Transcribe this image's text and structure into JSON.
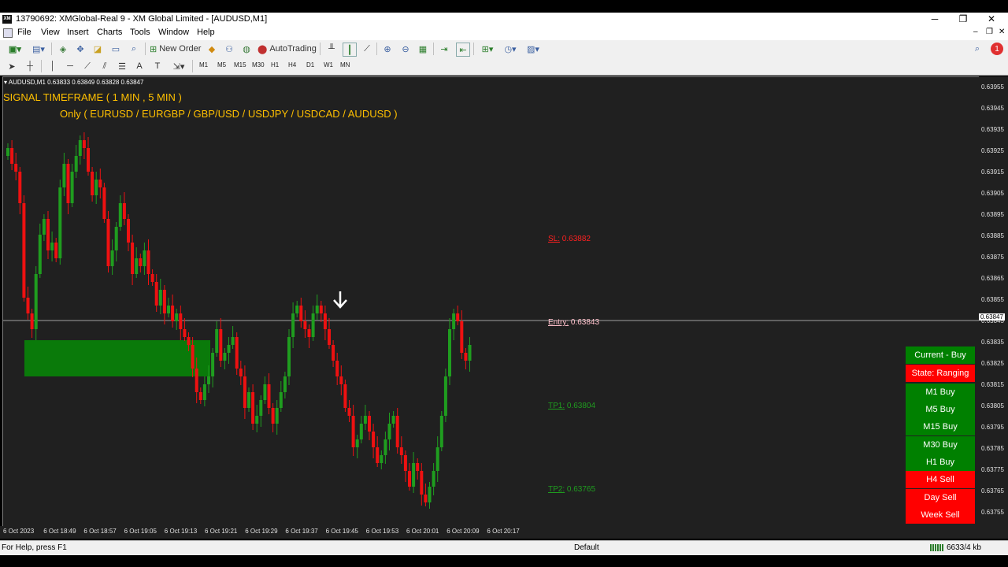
{
  "window": {
    "title": "13790692: XMGlobal-Real 9 - XM Global Limited - [AUDUSD,M1]",
    "logo_text": "XM",
    "controls": [
      "─",
      "❐",
      "✕"
    ]
  },
  "menu": [
    "File",
    "View",
    "Insert",
    "Charts",
    "Tools",
    "Window",
    "Help"
  ],
  "toolbar": {
    "new_order": "New Order",
    "autotrading": "AutoTrading"
  },
  "timeframes": [
    "M1",
    "M5",
    "M15",
    "M30",
    "H1",
    "H4",
    "D1",
    "W1",
    "MN"
  ],
  "chart": {
    "header": "AUDUSD,M1  0.63833 0.63849 0.63828 0.63847",
    "signal_title": "SIGNAL TIMEFRAME ( 1 MIN , 5 MIN )",
    "pairs_note": "Only ( EURUSD / EURGBP / GBP/USD / USDJPY / USDCAD / AUDUSD )",
    "current_price": "0.63847",
    "levels": [
      {
        "label": "SL:",
        "value": "0.63882",
        "color": "#ff2020"
      },
      {
        "label": "Entry:",
        "value": "0.63843",
        "color": "#ffc0cb"
      },
      {
        "label": "TP1:",
        "value": "0.63804",
        "color": "#1f9d1f"
      },
      {
        "label": "TP2:",
        "value": "0.63765",
        "color": "#1f9d1f"
      }
    ],
    "price_ticks": [
      "0.63955",
      "0.63945",
      "0.63935",
      "0.63925",
      "0.63915",
      "0.63905",
      "0.63895",
      "0.63885",
      "0.63875",
      "0.63865",
      "0.63855",
      "0.63845",
      "0.63835",
      "0.63825",
      "0.63815",
      "0.63805",
      "0.63795",
      "0.63785",
      "0.63775",
      "0.63765",
      "0.63755"
    ],
    "time_ticks": [
      "6 Oct 2023",
      "6 Oct 18:49",
      "6 Oct 18:57",
      "6 Oct 19:05",
      "6 Oct 19:13",
      "6 Oct 19:21",
      "6 Oct 19:29",
      "6 Oct 19:37",
      "6 Oct 19:45",
      "6 Oct 19:53",
      "6 Oct 20:01",
      "6 Oct 20:09",
      "6 Oct 20:17"
    ],
    "colors": {
      "bull": "#1f9d1f",
      "bear": "#ee1111",
      "background": "#202020",
      "signal": "#ffc000"
    }
  },
  "signal_panel": [
    {
      "text": "Current - Buy",
      "color": "#008000"
    },
    {
      "text": "State: Ranging",
      "color": "#ff0000"
    },
    {
      "text": "M1 Buy",
      "color": "#008000"
    },
    {
      "text": "M5 Buy",
      "color": "#008000"
    },
    {
      "text": "M15 Buy",
      "color": "#008000"
    },
    {
      "text": "M30 Buy",
      "color": "#008000"
    },
    {
      "text": "H1 Buy",
      "color": "#008000"
    },
    {
      "text": "H4 Sell",
      "color": "#ff0000"
    },
    {
      "text": "Day Sell",
      "color": "#ff0000"
    },
    {
      "text": "Week Sell",
      "color": "#ff0000"
    }
  ],
  "status": {
    "help": "For Help, press F1",
    "profile": "Default",
    "traffic": "6633/4 kb"
  }
}
